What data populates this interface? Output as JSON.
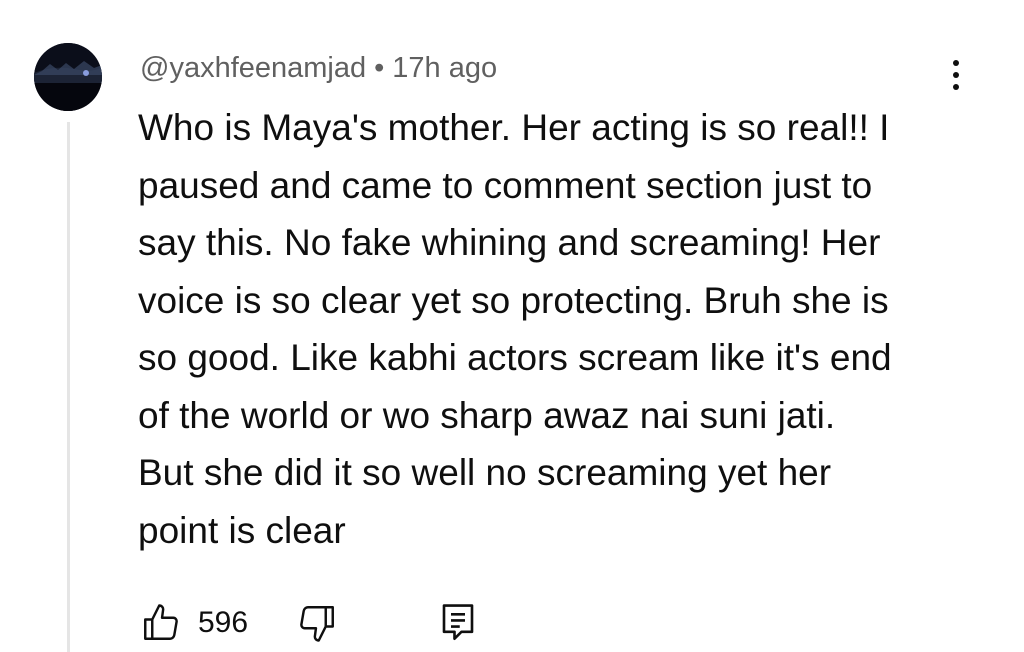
{
  "comment": {
    "username": "@yaxhfeenamjad",
    "separator": "•",
    "timestamp": "17h ago",
    "text_lines": [
      "Who is Maya's mother. Her acting is so real!! I",
      "paused and came to comment section just to",
      "say this. No fake whining and screaming! Her",
      "voice is so clear yet so protecting. Bruh she is",
      "so good. Like kabhi actors scream like it's end",
      "of the world or wo sharp awaz nai suni jati.",
      "But she did it so well no screaming yet her",
      "point is clear"
    ],
    "like_count": "596"
  },
  "icons": {
    "avatar": "avatar-image",
    "more": "more-vert-icon",
    "like": "thumbs-up-icon",
    "dislike": "thumbs-down-icon",
    "reply": "reply-comment-icon"
  },
  "colors": {
    "text_primary": "#0f0f0f",
    "text_secondary": "#606060",
    "thread_line": "#e5e5e5"
  }
}
